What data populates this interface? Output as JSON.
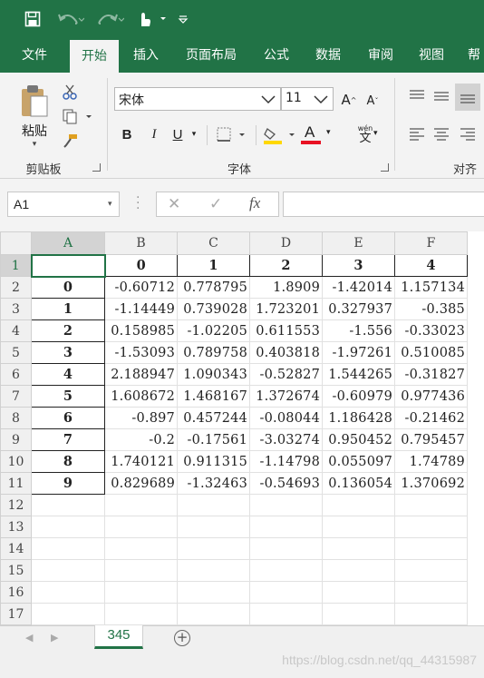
{
  "title_bar": {
    "icons": [
      "save-icon",
      "undo-icon",
      "redo-icon",
      "touch-mode-icon",
      "customize-quick-access-icon"
    ]
  },
  "ribbon_tabs": [
    "文件",
    "开始",
    "插入",
    "页面布局",
    "公式",
    "数据",
    "审阅",
    "视图",
    "帮"
  ],
  "active_tab": "开始",
  "clipboard": {
    "paste_label": "粘贴",
    "group_label": "剪贴板"
  },
  "font": {
    "name": "宋体",
    "size": "11",
    "group_label": "字体",
    "bold": "B",
    "italic": "I",
    "underline": "U",
    "grow": "A",
    "shrink": "A",
    "phonetic_top": "wén",
    "phonetic_bottom": "文",
    "font_color_letter": "A",
    "font_color": "#e81123",
    "fill_color": "#ffd800"
  },
  "alignment": {
    "group_label": "对齐"
  },
  "name_box": "A1",
  "formula_bar": {
    "cancel": "✕",
    "enter": "✓",
    "fx": "fx",
    "value": ""
  },
  "columns": [
    "A",
    "B",
    "C",
    "D",
    "E",
    "F"
  ],
  "rows": [
    "1",
    "2",
    "3",
    "4",
    "5",
    "6",
    "7",
    "8",
    "9",
    "10",
    "11",
    "12",
    "13",
    "14",
    "15",
    "16",
    "17"
  ],
  "sheet": {
    "header": [
      "",
      "0",
      "1",
      "2",
      "3",
      "4"
    ],
    "data": [
      [
        "0",
        "-0.60712",
        "0.778795",
        "1.8909",
        "-1.42014",
        "1.157134"
      ],
      [
        "1",
        "-1.14449",
        "0.739028",
        "1.723201",
        "0.327937",
        "-0.385"
      ],
      [
        "2",
        "0.158985",
        "-1.02205",
        "0.611553",
        "-1.556",
        "-0.33023"
      ],
      [
        "3",
        "-1.53093",
        "0.789758",
        "0.403818",
        "-1.97261",
        "0.510085"
      ],
      [
        "4",
        "2.188947",
        "1.090343",
        "-0.52827",
        "1.544265",
        "-0.31827"
      ],
      [
        "5",
        "1.608672",
        "1.468167",
        "1.372674",
        "-0.60979",
        "0.977436"
      ],
      [
        "6",
        "-0.897",
        "0.457244",
        "-0.08044",
        "1.186428",
        "-0.21462"
      ],
      [
        "7",
        "-0.2",
        "-0.17561",
        "-3.03274",
        "0.950452",
        "0.795457"
      ],
      [
        "8",
        "1.740121",
        "0.911315",
        "-1.14798",
        "0.055097",
        "1.74789"
      ],
      [
        "9",
        "0.829689",
        "-1.32463",
        "-0.54693",
        "0.136054",
        "1.370692"
      ]
    ]
  },
  "sheet_tabs": [
    "345"
  ],
  "watermark": "https://blog.csdn.net/qq_44315987",
  "colors": {
    "accent": "#217346",
    "ribbon_bg": "#f3f3f3"
  }
}
